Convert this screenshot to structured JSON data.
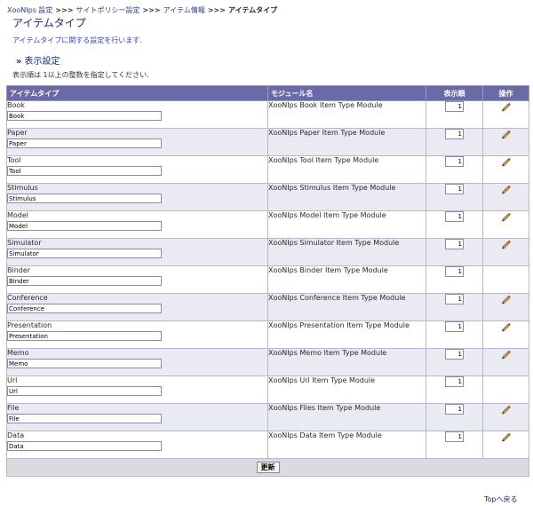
{
  "breadcrumb": {
    "items": [
      "XooNIps 設定",
      "サイトポリシー設定",
      "アイテム情報"
    ],
    "separator": ">>>",
    "current": "アイテムタイプ"
  },
  "page": {
    "title": "アイテムタイプ",
    "description": "アイテムタイプに関する設定を行います."
  },
  "section": {
    "marker": "»",
    "title": "表示設定",
    "note": "表示順は 1以上の整数を指定してください."
  },
  "table": {
    "headers": {
      "type": "アイテムタイプ",
      "module": "モジュール名",
      "order": "表示順",
      "operation": "操作"
    },
    "rows": [
      {
        "label": "Book",
        "value": "Book",
        "module": "XooNIps Book Item Type Module",
        "order": "1",
        "editable": true
      },
      {
        "label": "Paper",
        "value": "Paper",
        "module": "XooNIps Paper Item Type Module",
        "order": "1",
        "editable": true
      },
      {
        "label": "Tool",
        "value": "Tool",
        "module": "XooNIps Tool Item Type Module",
        "order": "1",
        "editable": true
      },
      {
        "label": "Stimulus",
        "value": "Stimulus",
        "module": "XooNIps Stimulus Item Type Module",
        "order": "1",
        "editable": true
      },
      {
        "label": "Model",
        "value": "Model",
        "module": "XooNIps Model Item Type Module",
        "order": "1",
        "editable": true
      },
      {
        "label": "Simulator",
        "value": "Simulator",
        "module": "XooNIps Simulator Item Type Module",
        "order": "1",
        "editable": true
      },
      {
        "label": "Binder",
        "value": "Binder",
        "module": "XooNIps Binder Item Type Module",
        "order": "1",
        "editable": false
      },
      {
        "label": "Conference",
        "value": "Conference",
        "module": "XooNIps Conference Item Type Module",
        "order": "1",
        "editable": true
      },
      {
        "label": "Presentation",
        "value": "Presentation",
        "module": "XooNIps Presentation Item Type Module",
        "order": "1",
        "editable": true
      },
      {
        "label": "Memo",
        "value": "Memo",
        "module": "XooNIps Memo Item Type Module",
        "order": "1",
        "editable": true
      },
      {
        "label": "Url",
        "value": "Url",
        "module": "XooNIps Url Item Type Module",
        "order": "1",
        "editable": false
      },
      {
        "label": "File",
        "value": "File",
        "module": "XooNIps Files Item Type Module",
        "order": "1",
        "editable": true
      },
      {
        "label": "Data",
        "value": "Data",
        "module": "XooNIps Data Item Type Module",
        "order": "1",
        "editable": true
      }
    ],
    "update_label": "更新"
  },
  "footer": {
    "top_link": "Topへ戻る"
  },
  "colors": {
    "header_bg": "#6b6aa9",
    "row_alt_bg": "#eaeaf2",
    "title_color": "#1a2b6d"
  },
  "icons": {
    "edit": "pencil-icon"
  }
}
